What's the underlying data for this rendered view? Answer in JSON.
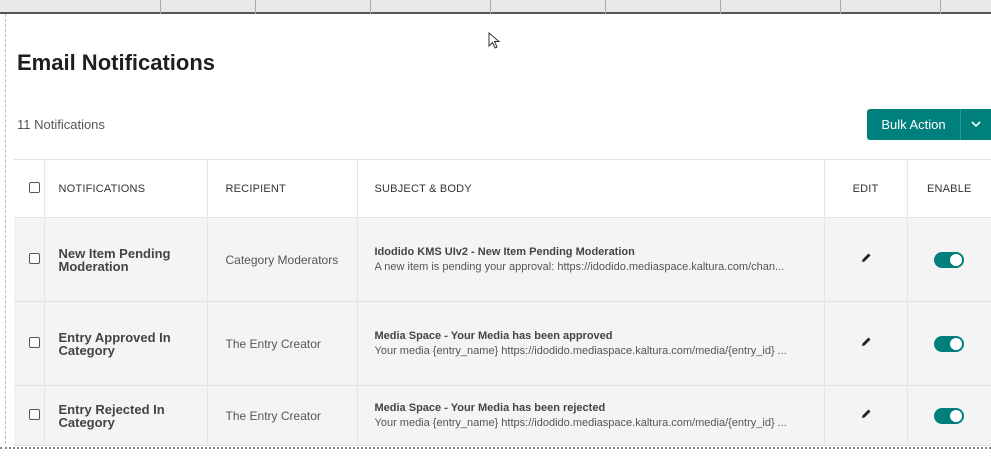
{
  "page": {
    "title": "Email Notifications",
    "count_label": "11 Notifications"
  },
  "bulk_action": {
    "label": "Bulk Action",
    "icon": "chevron-down-icon"
  },
  "table": {
    "headers": {
      "notifications": "NOTIFICATIONS",
      "recipient": "RECIPIENT",
      "subject_body": "SUBJECT & BODY",
      "edit": "EDIT",
      "enable": "ENABLE"
    },
    "rows": [
      {
        "name": "New Item Pending Moderation",
        "recipient": "Category Moderators",
        "subject": "Idodido KMS UIv2 - New Item Pending Moderation",
        "body": "A new item is pending your approval: https://idodido.mediaspace.kaltura.com/chan...",
        "enabled": true
      },
      {
        "name": "Entry Approved In Category",
        "recipient": "The Entry Creator",
        "subject": "Media Space - Your Media has been approved",
        "body": "Your media {entry_name} https://idodido.mediaspace.kaltura.com/media/{entry_id} ...",
        "enabled": true
      },
      {
        "name": "Entry Rejected In Category",
        "recipient": "The Entry Creator",
        "subject": "Media Space - Your Media has been rejected",
        "body": "Your media {entry_name} https://idodido.mediaspace.kaltura.com/media/{entry_id} ...",
        "enabled": true
      }
    ]
  },
  "colors": {
    "accent": "#00807d",
    "row_bg": "#f4f4f4"
  }
}
